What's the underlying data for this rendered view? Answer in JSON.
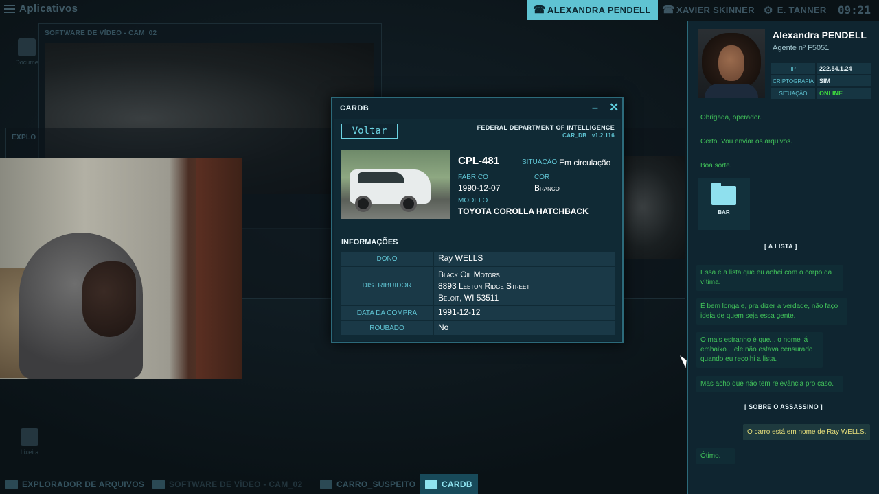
{
  "topbar": {
    "apps_label": "Aplicativos",
    "contacts": [
      {
        "name": "ALEXANDRA PENDELL",
        "active": true
      },
      {
        "name": "XAVIER SKINNER",
        "active": false
      },
      {
        "name": "E. TANNER",
        "active": false
      }
    ],
    "clock": "09:21"
  },
  "desktop": {
    "video_window_title": "SOFTWARE DE VÍDEO - CAM_02",
    "explorer_window_title": "EXPLO",
    "documents_icon": "Docume",
    "trash_icon": "Lixeira"
  },
  "cardb": {
    "title": "CARDB",
    "back_button": "Voltar",
    "agency": "FEDERAL DEPARTMENT OF INTELLIGENCE",
    "db_name": "CAR_DB",
    "version": "v1.2.116",
    "plate": "CPL-481",
    "status_label": "SITUAÇÃO",
    "status_value": "Em circulação",
    "manufactured_label": "FABRICO",
    "manufactured_value": "1990-12-07",
    "color_label": "COR",
    "color_value": "Branco",
    "model_label": "MODELO",
    "model_value": "TOYOTA COROLLA HATCHBACK",
    "info_heading": "INFORMAÇÕES",
    "info": [
      {
        "key": "DONO",
        "value": "Ray WELLS"
      },
      {
        "key": "DISTRIBUIDOR",
        "value_lines": [
          "Black Oil Motors",
          "8893 Leeton Ridge Street",
          "Beloit, WI 53511"
        ]
      },
      {
        "key": "DATA DA COMPRA",
        "value": "1991-12-12"
      },
      {
        "key": "ROUBADO",
        "value": "No"
      }
    ]
  },
  "agent": {
    "name": "Alexandra PENDELL",
    "id": "Agente nº F5051",
    "meta": [
      {
        "key": "IP",
        "value": "222.54.1.24"
      },
      {
        "key": "CRIPTOGRAFIA",
        "value": "SIM"
      },
      {
        "key": "SITUAÇÃO",
        "value": "ONLINE"
      }
    ]
  },
  "chat": {
    "messages_top": [
      "Obrigada, operador.",
      "Certo. Vou enviar os arquivos.",
      "Boa sorte."
    ],
    "attachment": "BAR",
    "separator_1": "[   A LISTA   ]",
    "messages_mid": [
      "Essa é a lista que eu achei com o corpo da vítima.",
      "É bem longa e, pra dizer a verdade, não faço ideia de quem seja essa gente.",
      "O mais estranho é que... o nome lá embaixo... ele não estava censurado quando eu recolhi a lista.",
      "Mas acho que não tem relevância pro caso."
    ],
    "separator_2": "[   SOBRE O ASSASSINO   ]",
    "outgoing": "O carro está em nome de Ray WELLS.",
    "reply": "Ótimo."
  },
  "taskbar": [
    {
      "label": "EXPLORADOR DE ARQUIVOS",
      "active": false
    },
    {
      "label": "SOFTWARE DE VÍDEO - CAM_02",
      "active": false
    },
    {
      "label": "CARRO_SUSPEITO",
      "active": false
    },
    {
      "label": "CARDB",
      "active": true
    }
  ]
}
